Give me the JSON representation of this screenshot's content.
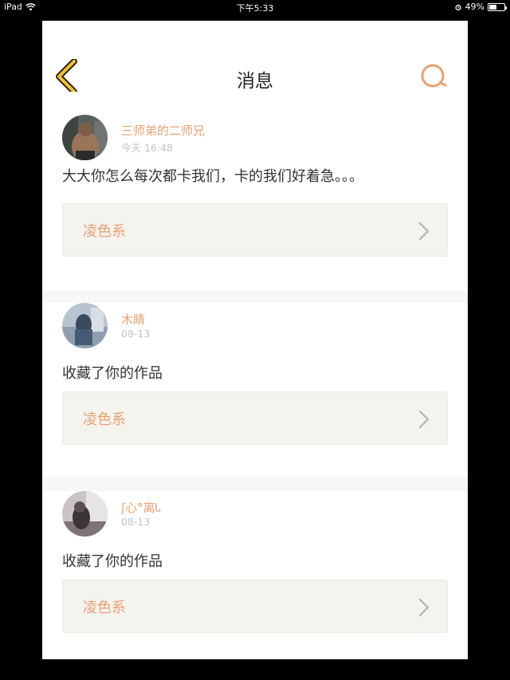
{
  "status_bar": {
    "device": "iPad",
    "time": "下午5:33",
    "battery": "49%",
    "battery_level": 0.49,
    "icons": [
      "wifi-icon",
      "alarm-icon",
      "battery-icon"
    ]
  },
  "nav": {
    "title": "消息",
    "back_icon": "chevron-left-icon",
    "search_icon": "search-icon"
  },
  "colors": {
    "accent": "#e9a071",
    "back_icon": "#f2c12e",
    "timestamp": "#c2c2c2",
    "work_box_bg": "#f4f3ee"
  },
  "messages": [
    {
      "user": "三师弟的二师兄",
      "time": "今天 16:48",
      "text": "大大你怎么每次都卡我们，卡的我们好着急。。。",
      "work": "凌色系"
    },
    {
      "user": "木睛",
      "time": "08-13",
      "text": "收藏了你的作品",
      "work": "凌色系"
    },
    {
      "user": "ʃ心°离Ꮣ",
      "time": "08-13",
      "text": "收藏了你的作品",
      "work": "凌色系"
    }
  ]
}
